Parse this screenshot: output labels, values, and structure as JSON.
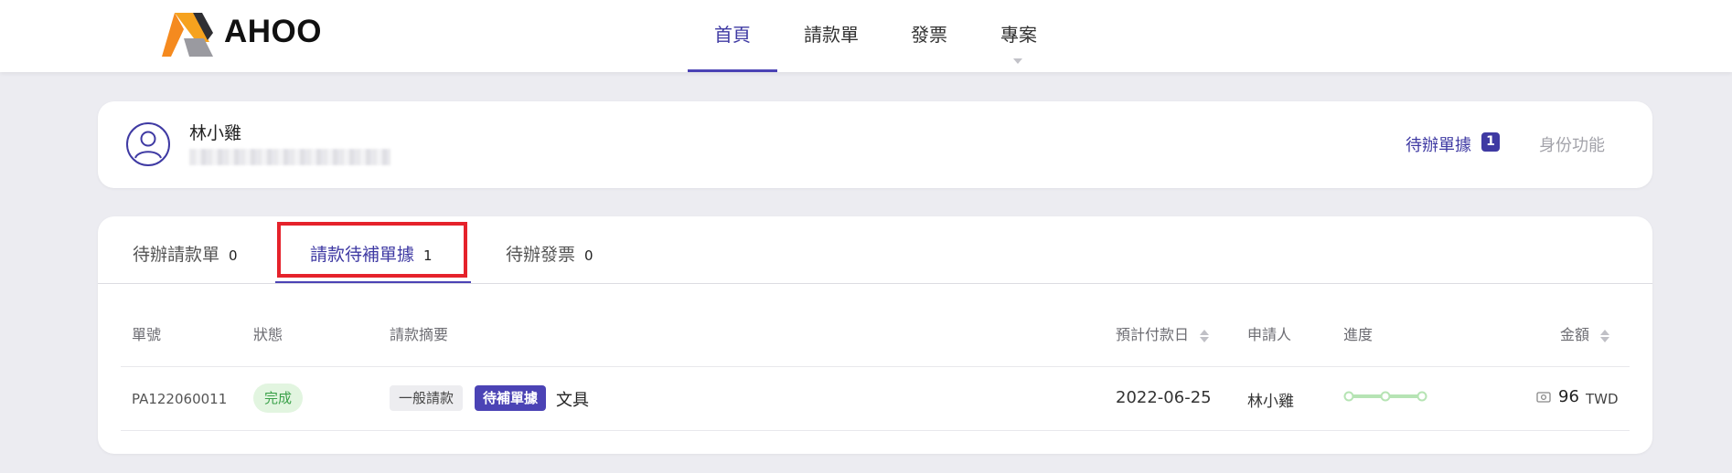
{
  "app": {
    "logo_text": "AHOO",
    "nav": [
      {
        "label": "首頁",
        "active": true
      },
      {
        "label": "請款單",
        "active": false
      },
      {
        "label": "發票",
        "active": false
      },
      {
        "label": "專案",
        "active": false
      }
    ]
  },
  "profile": {
    "name": "林小雞",
    "pending_docs_label": "待辦單據",
    "pending_docs_count": "1",
    "identity_label": "身份功能"
  },
  "tabs": [
    {
      "label": "待辦請款單",
      "count": "0",
      "active": false
    },
    {
      "label": "請款待補單據",
      "count": "1",
      "active": true
    },
    {
      "label": "待辦發票",
      "count": "0",
      "active": false
    }
  ],
  "table": {
    "headers": {
      "doc_no": "單號",
      "status": "狀態",
      "summary": "請款摘要",
      "pay_date": "預計付款日",
      "applicant": "申請人",
      "progress": "進度",
      "amount": "金額"
    },
    "rows": [
      {
        "doc_no": "PA122060011",
        "status": "完成",
        "tag_general": "一般請款",
        "tag_pending": "待補單據",
        "summary": "文具",
        "pay_date": "2022-06-25",
        "applicant": "林小雞",
        "progress_steps_done": 3,
        "progress_steps_total": 3,
        "amount": "96",
        "currency": "TWD"
      }
    ]
  },
  "colors": {
    "accent": "#3f3aa3",
    "accent_dark": "#4b43b5",
    "highlight_box": "#e5222b",
    "status_bg": "#e2f5e0",
    "status_text": "#3ba14a",
    "progress": "#b6e4b4",
    "page_bg": "#ececf1"
  },
  "icons": {
    "logo": "ahoo-logo-icon",
    "avatar": "user-avatar-icon",
    "sort": "sort-arrows-icon",
    "money": "cash-icon",
    "caret": "caret-down-icon"
  }
}
